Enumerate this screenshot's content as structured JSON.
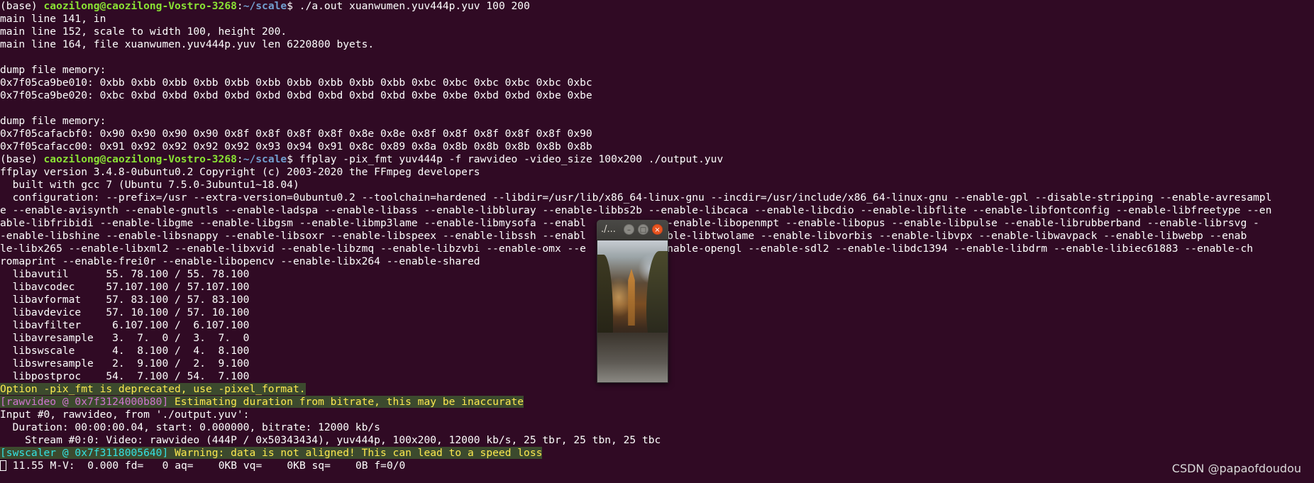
{
  "terminal": {
    "prompt": {
      "env": "(base) ",
      "user_host": "caozilong@caozilong-Vostro-3268",
      "colon": ":",
      "path": "~/scale",
      "dollar": "$ "
    },
    "cmd1": "./a.out xuanwumen.yuv444p.yuv 100 200",
    "out_lines_1": [
      "main line 141, in",
      "main line 152, scale to width 100, height 200.",
      "main line 164, file xuanwumen.yuv444p.yuv len 6220800 byets.",
      "",
      "dump file memory:",
      "0x7f05ca9be010: 0xbb 0xbb 0xbb 0xbb 0xbb 0xbb 0xbb 0xbb 0xbb 0xbb 0xbc 0xbc 0xbc 0xbc 0xbc 0xbc",
      "0x7f05ca9be020: 0xbc 0xbd 0xbd 0xbd 0xbd 0xbd 0xbd 0xbd 0xbd 0xbd 0xbe 0xbe 0xbd 0xbd 0xbe 0xbe",
      "",
      "dump file memory:",
      "0x7f05cafacbf0: 0x90 0x90 0x90 0x90 0x8f 0x8f 0x8f 0x8f 0x8e 0x8e 0x8f 0x8f 0x8f 0x8f 0x8f 0x90",
      "0x7f05cafacc00: 0x91 0x92 0x92 0x92 0x92 0x93 0x94 0x91 0x8c 0x89 0x8a 0x8b 0x8b 0x8b 0x8b 0x8b"
    ],
    "cmd2": "ffplay -pix_fmt yuv444p -f rawvideo -video_size 100x200 ./output.yuv",
    "out_lines_2": [
      "ffplay version 3.4.8-0ubuntu0.2 Copyright (c) 2003-2020 the FFmpeg developers",
      "  built with gcc 7 (Ubuntu 7.5.0-3ubuntu1~18.04)",
      "  configuration: --prefix=/usr --extra-version=0ubuntu0.2 --toolchain=hardened --libdir=/usr/lib/x86_64-linux-gnu --incdir=/usr/include/x86_64-linux-gnu --enable-gpl --disable-stripping --enable-avresampl",
      "e --enable-avisynth --enable-gnutls --enable-ladspa --enable-libass --enable-libbluray --enable-libbs2b --enable-libcaca --enable-libcdio --enable-libflite --enable-libfontconfig --enable-libfreetype --en",
      "able-libfribidi --enable-libgme --enable-libgsm --enable-libmp3lame --enable-libmysofa --enabl        peg --enable-libopenmpt --enable-libopus --enable-libpulse --enable-librubberband --enable-librsvg -",
      "-enable-libshine --enable-libsnappy --enable-libsoxr --enable-libspeex --enable-libssh --enabl        --enable-libtwolame --enable-libvorbis --enable-libvpx --enable-libwavpack --enable-libwebp --enab",
      "le-libx265 --enable-libxml2 --enable-libxvid --enable-libzmq --enable-libzvbi --enable-omx --e        l --enable-opengl --enable-sdl2 --enable-libdc1394 --enable-libdrm --enable-libiec61883 --enable-ch",
      "romaprint --enable-frei0r --enable-libopencv --enable-libx264 --enable-shared",
      "  libavutil      55. 78.100 / 55. 78.100",
      "  libavcodec     57.107.100 / 57.107.100",
      "  libavformat    57. 83.100 / 57. 83.100",
      "  libavdevice    57. 10.100 / 57. 10.100",
      "  libavfilter     6.107.100 /  6.107.100",
      "  libavresample   3.  7.  0 /  3.  7.  0",
      "  libswscale      4.  8.100 /  4.  8.100",
      "  libswresample   2.  9.100 /  2.  9.100",
      "  libpostproc    54.  7.100 / 54.  7.100"
    ],
    "deprecated_warning": "Option -pix_fmt is deprecated, use -pixel_format.",
    "rawvideo_tag": "[rawvideo @ 0x7f3124000b80]",
    "rawvideo_msg": " Estimating duration from bitrate, this may be inaccurate",
    "out_lines_3": [
      "Input #0, rawvideo, from './output.yuv':",
      "  Duration: 00:00:00.04, start: 0.000000, bitrate: 12000 kb/s",
      "    Stream #0:0: Video: rawvideo (444P / 0x50343434), yuv444p, 100x200, 12000 kb/s, 25 tbr, 25 tbn, 25 tbc"
    ],
    "swscaler_tag": "[swscaler @ 0x7f3118005640]",
    "swscaler_msg": " Warning: data is not aligned! This can lead to a speed loss",
    "status_line": " 11.55 M-V:  0.000 fd=   0 aq=    0KB vq=    0KB sq=    0B f=0/0"
  },
  "ffplay_window": {
    "title": "./...",
    "minimize_glyph": "–",
    "maximize_glyph": "□",
    "close_glyph": "×"
  },
  "watermark": "CSDN @papaofdoudou",
  "colors": {
    "background": "#300a24",
    "prompt_user": "#8ae234",
    "prompt_path": "#729fcf",
    "warning": "#fce94f",
    "rawvideo_tag": "#d074d0",
    "swscaler_tag": "#34e2e2",
    "close_button": "#e95420"
  }
}
